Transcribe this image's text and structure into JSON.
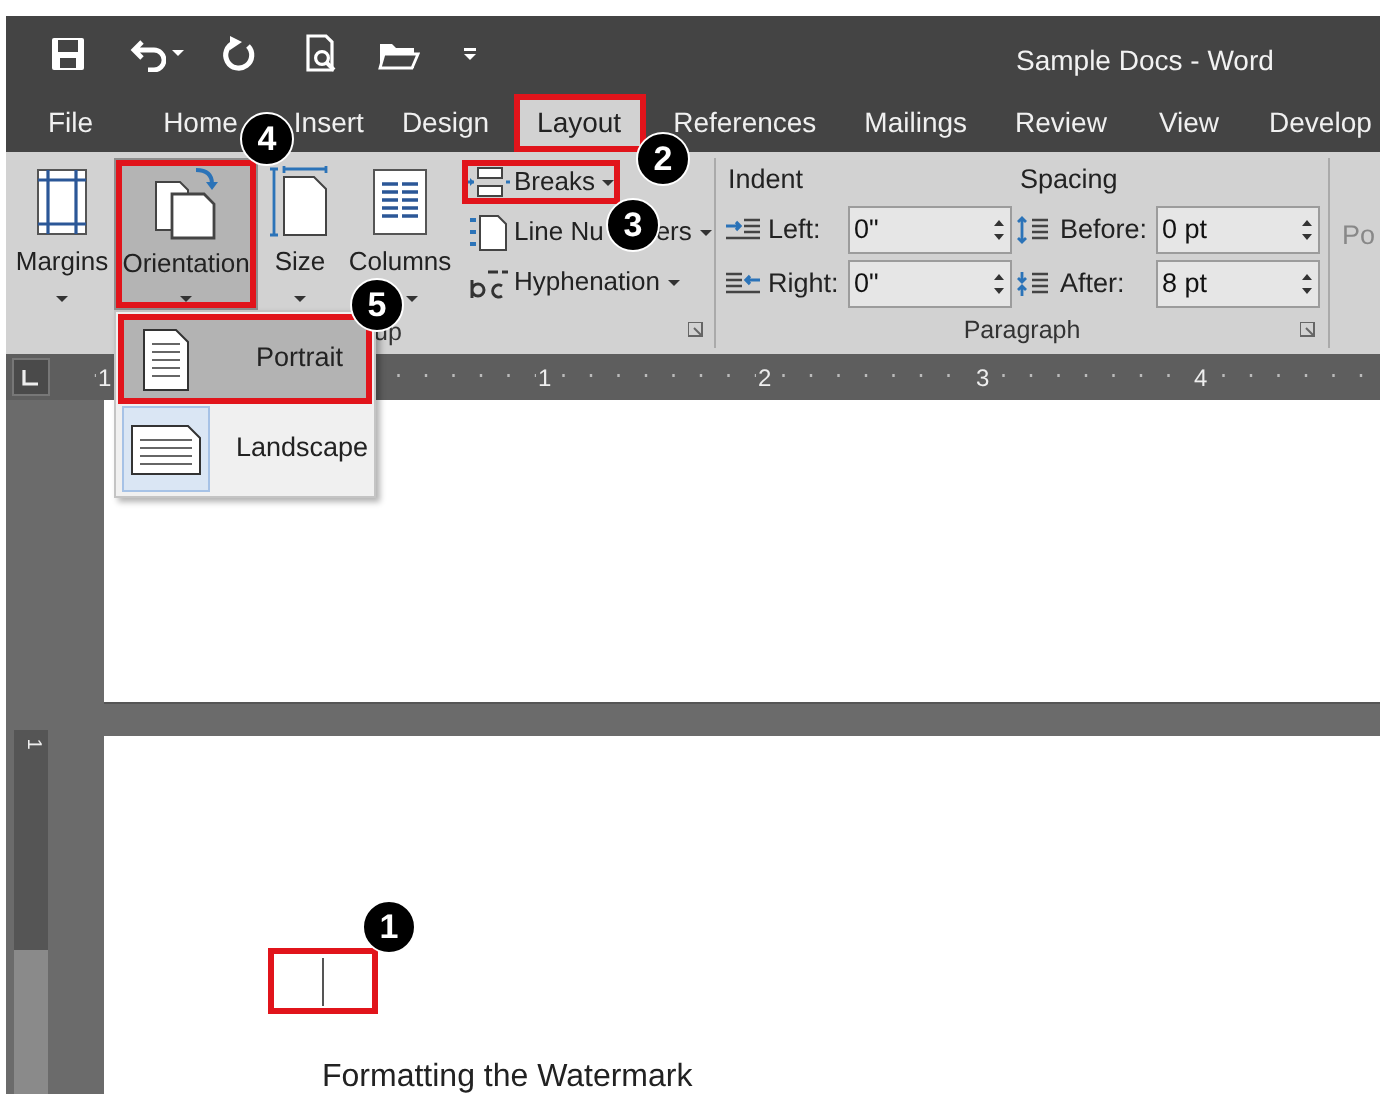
{
  "window": {
    "title": "Sample Docs - Word"
  },
  "tabs": [
    {
      "label": "File",
      "selected": false,
      "marked": false
    },
    {
      "label": "Home",
      "selected": false,
      "marked": false
    },
    {
      "label": "Insert",
      "selected": false,
      "marked": false
    },
    {
      "label": "Design",
      "selected": false,
      "marked": false
    },
    {
      "label": "Layout",
      "selected": true,
      "marked": true
    },
    {
      "label": "References",
      "selected": false,
      "marked": false
    },
    {
      "label": "Mailings",
      "selected": false,
      "marked": false
    },
    {
      "label": "Review",
      "selected": false,
      "marked": false
    },
    {
      "label": "View",
      "selected": false,
      "marked": false
    },
    {
      "label": "Develop",
      "selected": false,
      "marked": false
    }
  ],
  "page_setup": {
    "large_buttons": [
      {
        "kind": "margins",
        "label": "Margins",
        "pressed": false,
        "marked": false
      },
      {
        "kind": "orientation",
        "label": "Orientation",
        "pressed": true,
        "marked": true
      },
      {
        "kind": "size",
        "label": "Size",
        "pressed": false,
        "marked": false
      },
      {
        "kind": "columns",
        "label": "Columns",
        "pressed": false,
        "marked": false
      }
    ],
    "small_buttons": [
      {
        "kind": "breaks",
        "label": "Breaks",
        "marked": true
      },
      {
        "kind": "line_numbers",
        "label_parts": [
          "Line Nu",
          "ers"
        ],
        "marked": false
      },
      {
        "kind": "hyphenation",
        "label": "Hyphenation",
        "marked": false
      }
    ],
    "group_label": "up"
  },
  "paragraph": {
    "indent_label": "Indent",
    "spacing_label": "Spacing",
    "indent_fields": [
      {
        "kind": "left",
        "label": "Left:",
        "value": "0\""
      },
      {
        "kind": "right",
        "label": "Right:",
        "value": "0\""
      }
    ],
    "spacing_fields": [
      {
        "kind": "before",
        "label": "Before:",
        "value": "0 pt"
      },
      {
        "kind": "after",
        "label": "After:",
        "value": "8 pt"
      }
    ],
    "group_label": "Paragraph"
  },
  "next_group_label": "Po",
  "ruler": {
    "numbers": [
      "1",
      "1",
      "2",
      "3",
      "4"
    ]
  },
  "vertical_ruler": {
    "number": "1"
  },
  "orientation_menu": [
    {
      "kind": "portrait",
      "label": "Portrait",
      "hovered": true,
      "selected": false,
      "marked": true
    },
    {
      "kind": "landscape",
      "label": "Landscape",
      "hovered": false,
      "selected": true,
      "marked": false
    }
  ],
  "document": {
    "cursor_marked": true,
    "heading": "Formatting the Watermark"
  },
  "annotations": [
    {
      "number": "1"
    },
    {
      "number": "2"
    },
    {
      "number": "3"
    },
    {
      "number": "4"
    },
    {
      "number": "5"
    }
  ]
}
